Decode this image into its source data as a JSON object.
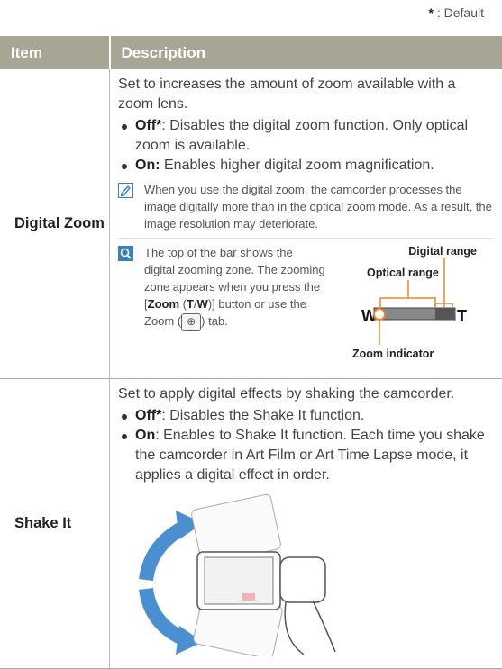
{
  "legend": {
    "star": "*",
    "text": " : Default"
  },
  "table": {
    "headers": {
      "item": "Item",
      "description": "Description"
    },
    "digital_zoom": {
      "item": "Digital Zoom",
      "intro": "Set to increases the amount of zoom available with a zoom lens.",
      "options": [
        {
          "name": "Off*",
          "text": ": Disables the digital zoom function. Only optical zoom is available."
        },
        {
          "name": "On:",
          "text": " Enables higher digital zoom magnification."
        }
      ],
      "note": "When you use the digital zoom, the camcorder processes the image digitally more than in the optical zoom mode. As a result, the image resolution may deteriorate.",
      "tip": {
        "line1": "The top of the bar shows the digital zooming zone.",
        "line2": "The zooming zone appears when you press the [",
        "zoom_label": "Zoom",
        "paren_open": " (",
        "t_label": "T",
        "slash": "/",
        "w_label": "W",
        "line3": ")] button or use the Zoom (",
        "line4": ") tab.",
        "zoom_icon": "⊕"
      },
      "diagram": {
        "digital_range": "Digital range",
        "optical_range": "Optical range",
        "zoom_indicator": "Zoom indicator",
        "w": "W",
        "t": "T",
        "accent_color": "#e8892b"
      }
    },
    "shake_it": {
      "item": "Shake It",
      "intro": "Set to apply digital effects by shaking the camcorder.",
      "options": [
        {
          "name": "Off*",
          "text": ": Disables the Shake It function."
        },
        {
          "name": "On",
          "text": ": Enables to Shake It function. Each time you shake the camcorder in Art Film or Art Time Lapse mode, it applies a digital effect in order."
        }
      ]
    }
  },
  "colors": {
    "header_bg": "#a7a593",
    "icon_blue": "#3a7fc0",
    "arrow_blue": "#4a8fd0"
  }
}
